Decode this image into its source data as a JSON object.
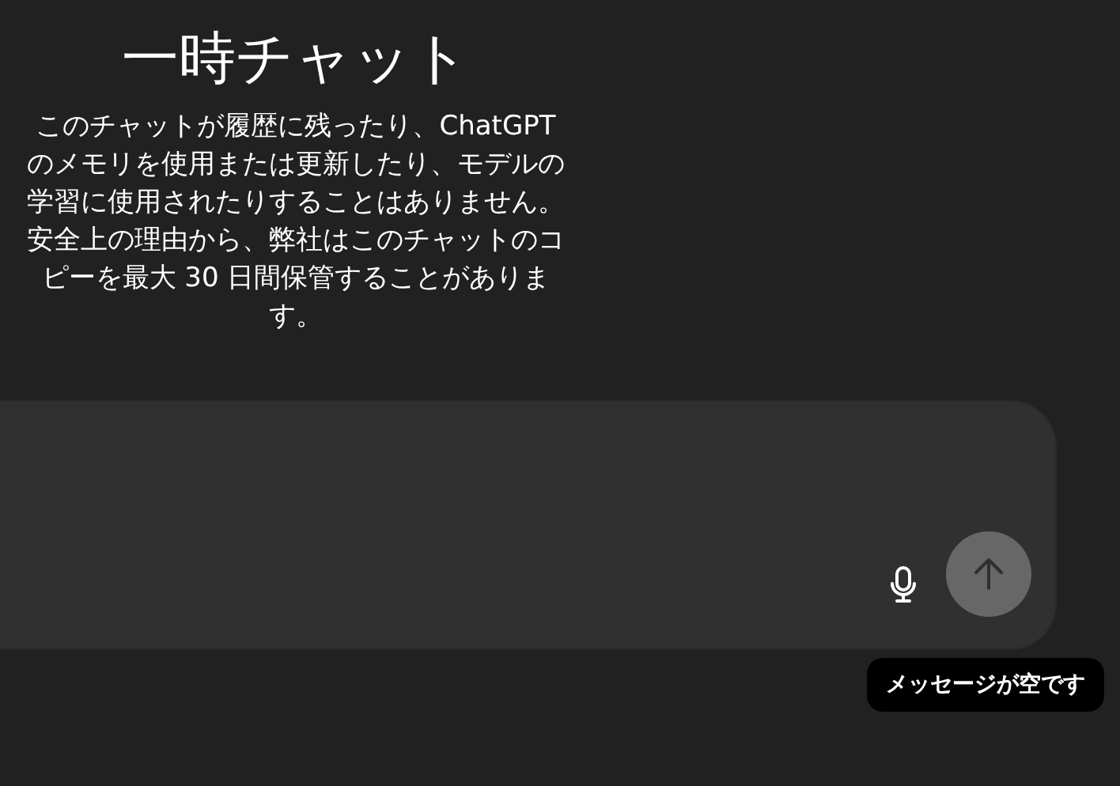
{
  "header": {
    "title": "一時チャット",
    "description": "このチャットが履歴に残ったり、ChatGPT のメモリを使用または更新したり、モデルの学習に使用されたりすることはありません。安全上の理由から、弊社はこのチャットのコピーを最大 30 日間保管することがあります。"
  },
  "composer": {
    "send_button": {
      "disabled": true
    },
    "tooltip": "メッセージが空です"
  }
}
